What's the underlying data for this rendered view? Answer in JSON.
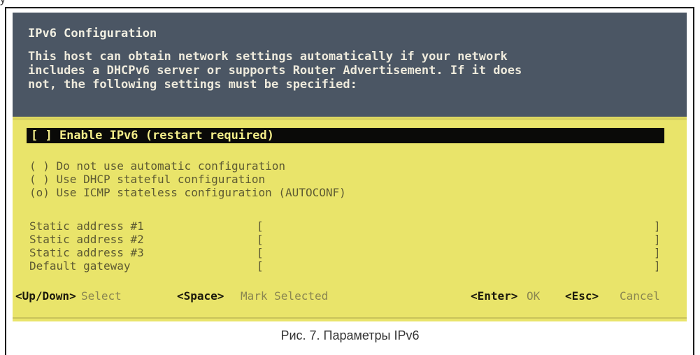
{
  "top_strip_text": "у                                                     ",
  "screen": {
    "title": "IPv6 Configuration",
    "description": [
      "This host can obtain network settings automatically if your network",
      "includes a DHCPv6 server or supports Router Advertisement. If it does",
      "not, the following settings must be specified:"
    ],
    "enable_option": "[ ] Enable IPv6 (restart required)",
    "radio_options": [
      "( ) Do not use automatic configuration",
      "( ) Use DHCP stateful configuration",
      "(o) Use ICMP stateless configuration (AUTOCONF)"
    ],
    "fields": [
      {
        "label": "Static address #1",
        "open": "[",
        "value": "",
        "close": "]"
      },
      {
        "label": "Static address #2",
        "open": "[",
        "value": "",
        "close": "]"
      },
      {
        "label": "Static address #3",
        "open": "[",
        "value": "",
        "close": "]"
      },
      {
        "label": "Default gateway",
        "open": "[",
        "value": "",
        "close": "]"
      }
    ],
    "footer": {
      "updown_key": "<Up/Down>",
      "updown_action": "Select",
      "space_key": "<Space>",
      "space_action": "Mark Selected",
      "enter_key": "<Enter>",
      "enter_action": "OK",
      "esc_key": "<Esc>",
      "esc_action": "Cancel"
    }
  },
  "caption": "Рис. 7. Параметры IPv6",
  "colors": {
    "header_bg": "#4b5664",
    "body_bg": "#e9e46a",
    "selected_bg": "#0a0a08",
    "selected_fg": "#f4ee8a"
  }
}
